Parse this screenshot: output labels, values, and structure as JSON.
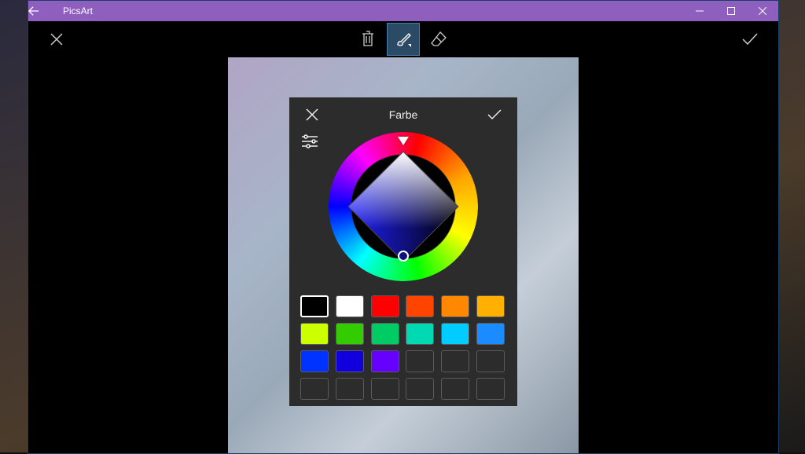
{
  "titlebar": {
    "app_name": "PicsArt"
  },
  "toolbar": {
    "tools": [
      "trash",
      "brush",
      "eraser"
    ],
    "active_tool": "brush"
  },
  "color_panel": {
    "title": "Farbe",
    "selected_hue": "blue",
    "swatch_rows": [
      [
        {
          "color": "#000000",
          "selected": true
        },
        {
          "color": "#ffffff"
        },
        {
          "color": "#ff0000"
        },
        {
          "color": "#ff4400"
        },
        {
          "color": "#ff8800"
        },
        {
          "color": "#ffb000"
        }
      ],
      [
        {
          "color": "#ccff00"
        },
        {
          "color": "#33cc00"
        },
        {
          "color": "#00cc66"
        },
        {
          "color": "#00d9b2"
        },
        {
          "color": "#00ccff"
        },
        {
          "color": "#1a8cff"
        }
      ],
      [
        {
          "color": "#0033ff"
        },
        {
          "color": "#1100dd"
        },
        {
          "color": "#6600ff"
        },
        {
          "empty": true
        },
        {
          "empty": true
        },
        {
          "empty": true
        }
      ],
      [
        {
          "empty": true
        },
        {
          "empty": true
        },
        {
          "empty": true
        },
        {
          "empty": true
        },
        {
          "empty": true
        },
        {
          "empty": true
        }
      ]
    ]
  }
}
